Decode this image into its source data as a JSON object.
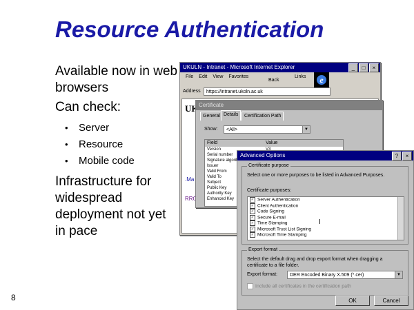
{
  "slide": {
    "title": "Resource Authentication",
    "bullets": [
      "Available now in web browsers",
      "Can check:",
      "Infrastructure for widespread deployment not yet in pace"
    ],
    "sub_bullets": [
      "Server",
      "Resource",
      "Mobile code"
    ],
    "page_number": "8"
  },
  "ie_window": {
    "title": "UKULN - Intranet - Microsoft Internet Explorer",
    "menu": [
      "File",
      "Edit",
      "View",
      "Favorites"
    ],
    "toolbar": [
      "Back",
      "Links"
    ],
    "address_label": "Address",
    "address_value": "https://intranet.ukoln.ac.uk",
    "page_heading": "UK",
    "page_snippets": [
      ".Ma",
      "RRO"
    ]
  },
  "cert_window": {
    "title": "Certificate",
    "tabs": [
      "General",
      "Details",
      "Certification Path"
    ],
    "show_label": "Show:",
    "show_value": "<All>",
    "col_field": "Field",
    "col_value": "Value",
    "fields": [
      "Version",
      "Serial number",
      "Signature algorithm",
      "Issuer",
      "Valid From",
      "Valid To",
      "Subject",
      "Public Key",
      "Authority Key",
      "Enhanced Key"
    ],
    "first_value": "V3"
  },
  "adv_dialog": {
    "title": "Advanced Options",
    "purpose_group": "Certificate purpose",
    "purpose_desc": "Select one or more purposes to be listed in Advanced Purposes.",
    "purposes_label": "Certificate purposes:",
    "purposes": [
      "Server Authentication",
      "Client Authentication",
      "Code Signing",
      "Secure E-mail",
      "Time Stamping",
      "Microsoft Trust List Signing",
      "Microsoft Time Stamping"
    ],
    "export_group": "Export format",
    "export_desc": "Select the default drag and drop export format when dragging a certificate to a file folder.",
    "export_label": "Export format:",
    "export_value": "DER Encoded Binary X.509 (*.cer)",
    "include_all": "Include all certificates in the certification path",
    "ok": "OK",
    "cancel": "Cancel"
  },
  "colors": {
    "title": "#1a1aa6",
    "titlebar": "#000080",
    "dialog_bg": "#c0c0c0"
  }
}
